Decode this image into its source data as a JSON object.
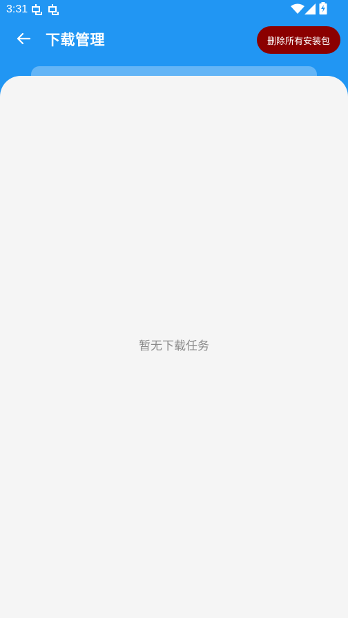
{
  "status_bar": {
    "time": "3:31",
    "notification_icons": [
      "bug-icon",
      "bug-icon"
    ],
    "system_icons": [
      "wifi-icon",
      "cell-signal-icon",
      "battery-charging-icon"
    ]
  },
  "app_bar": {
    "back_icon": "arrow-left-icon",
    "title": "下载管理",
    "delete_all_label": "删除所有安装包"
  },
  "content": {
    "empty_message": "暂无下载任务"
  },
  "colors": {
    "primary": "#2196F3",
    "accent_strip": "#64B5F6",
    "danger": "#8B0000",
    "panel_bg": "#F5F5F5",
    "empty_text": "#8A8A8A"
  }
}
